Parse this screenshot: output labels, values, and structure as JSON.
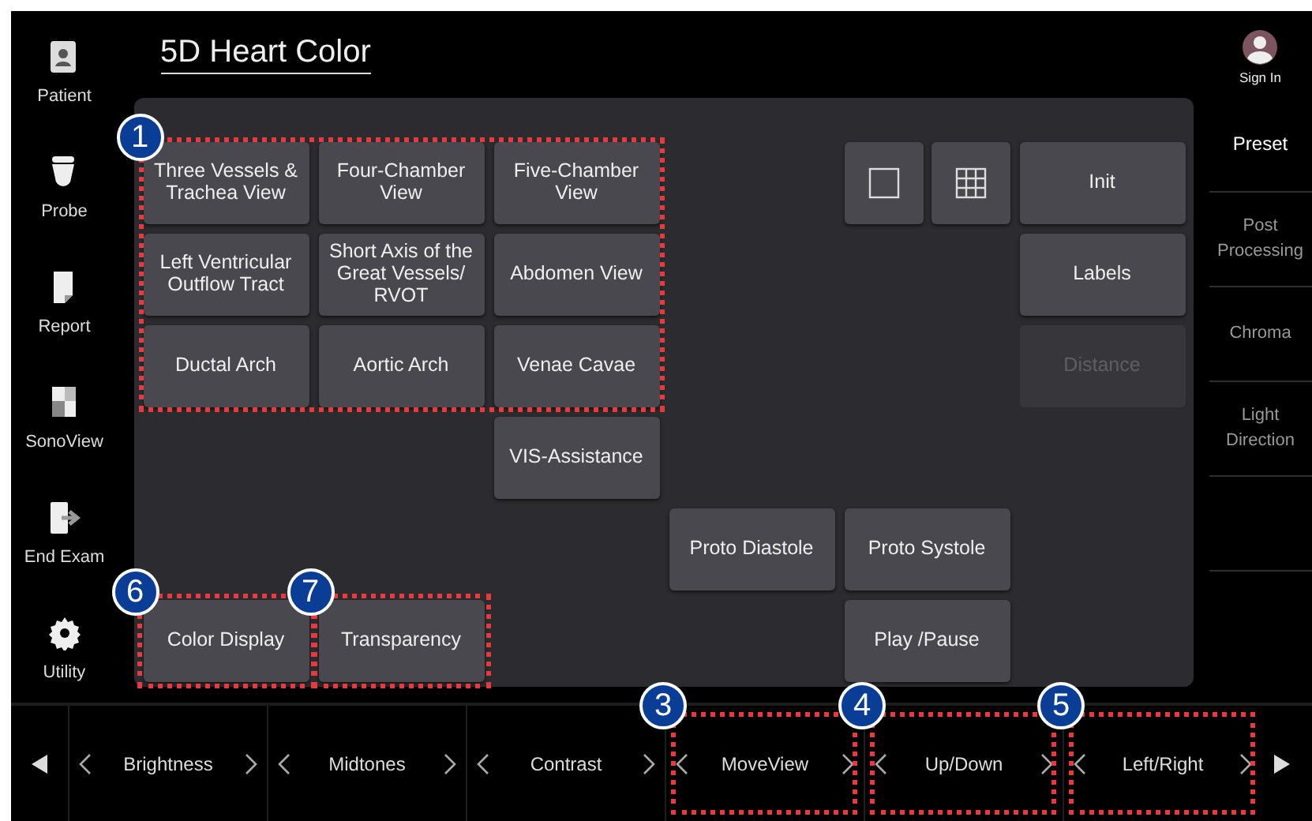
{
  "title": "5D Heart Color",
  "nav": [
    {
      "label": "Patient"
    },
    {
      "label": "Probe"
    },
    {
      "label": "Report"
    },
    {
      "label": "SonoView"
    },
    {
      "label": "End Exam"
    },
    {
      "label": "Utility"
    }
  ],
  "account": {
    "label": "Sign In"
  },
  "tabs": [
    {
      "label": "Preset",
      "selected": true
    },
    {
      "label": "Post Processing",
      "selected": false
    },
    {
      "label": "Chroma",
      "selected": false
    },
    {
      "label": "Light Direction",
      "selected": false
    }
  ],
  "panel": {
    "group_callout": "1",
    "buttons": [
      {
        "kind": "text",
        "label": "Three Vessels & Trachea View",
        "disabled": false
      },
      {
        "kind": "text",
        "label": "Four-Chamber View",
        "disabled": false
      },
      {
        "kind": "text",
        "label": "Five-Chamber View",
        "disabled": false
      },
      {
        "kind": "single-layout",
        "disabled": false
      },
      {
        "kind": "grid-layout",
        "disabled": false
      },
      {
        "kind": "text",
        "label": "Init",
        "disabled": false
      },
      {
        "kind": "text",
        "label": "Left Ventricular Outflow Tract",
        "disabled": false
      },
      {
        "kind": "text",
        "label": "Short Axis of the Great Vessels/ RVOT",
        "disabled": false
      },
      {
        "kind": "text",
        "label": "Abdomen View",
        "disabled": false
      },
      {
        "kind": "text",
        "label": "Labels",
        "disabled": false
      },
      {
        "kind": "text",
        "label": "Ductal Arch",
        "disabled": false
      },
      {
        "kind": "text",
        "label": "Aortic Arch",
        "disabled": false
      },
      {
        "kind": "text",
        "label": "Venae Cavae",
        "disabled": false
      },
      {
        "kind": "text",
        "label": "Distance",
        "disabled": true
      },
      {
        "kind": "text",
        "label": "VIS-Assistance",
        "disabled": false
      },
      {
        "kind": "text",
        "label": "Proto Diastole",
        "disabled": false
      },
      {
        "kind": "text",
        "label": "Proto Systole",
        "disabled": false
      },
      {
        "kind": "text",
        "label": "Color Display",
        "disabled": false,
        "callout": "6"
      },
      {
        "kind": "text",
        "label": "Transparency",
        "disabled": false,
        "callout": "7"
      },
      {
        "kind": "text",
        "label": "Play /Pause",
        "disabled": false
      }
    ]
  },
  "knobs": [
    {
      "label": "Brightness"
    },
    {
      "label": "Midtones"
    },
    {
      "label": "Contrast"
    },
    {
      "label": "MoveView",
      "callout": "3"
    },
    {
      "label": "Up/Down",
      "callout": "4"
    },
    {
      "label": "Left/Right",
      "callout": "5"
    }
  ]
}
